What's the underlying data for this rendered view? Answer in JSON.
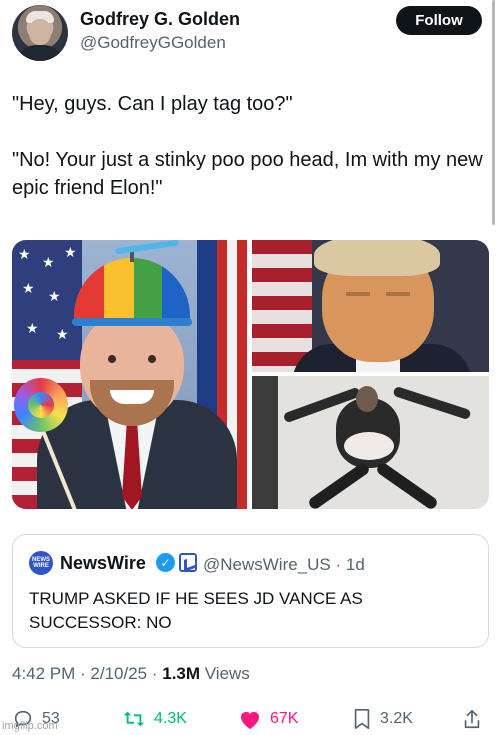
{
  "author": {
    "display_name": "Godfrey G. Golden",
    "handle": "@GodfreyGGolden",
    "follow_label": "Follow"
  },
  "tweet": {
    "line1": "\"Hey, guys. Can I play tag too?\"",
    "line2": "\"No! Your just a stinky poo poo head, Im with my new epic friend Elon!\""
  },
  "quote": {
    "avatar_text": "NEWS WIRE",
    "name": "NewsWire",
    "handle_time": "@NewsWire_US · 1d",
    "text": "TRUMP ASKED IF HE SEES JD VANCE AS SUCCESSOR: NO"
  },
  "meta": {
    "time_date": "4:42 PM · 2/10/25 · ",
    "views_count": "1.3M",
    "views_label": " Views"
  },
  "actions": {
    "replies": "53",
    "reposts": "4.3K",
    "likes": "67K",
    "bookmarks": "3.2K"
  },
  "colors": {
    "follow_bg": "#0f1419",
    "repost": "#00ba7c",
    "like": "#f91880",
    "verified": "#1d9bf0"
  },
  "watermark": "imgflip.com"
}
